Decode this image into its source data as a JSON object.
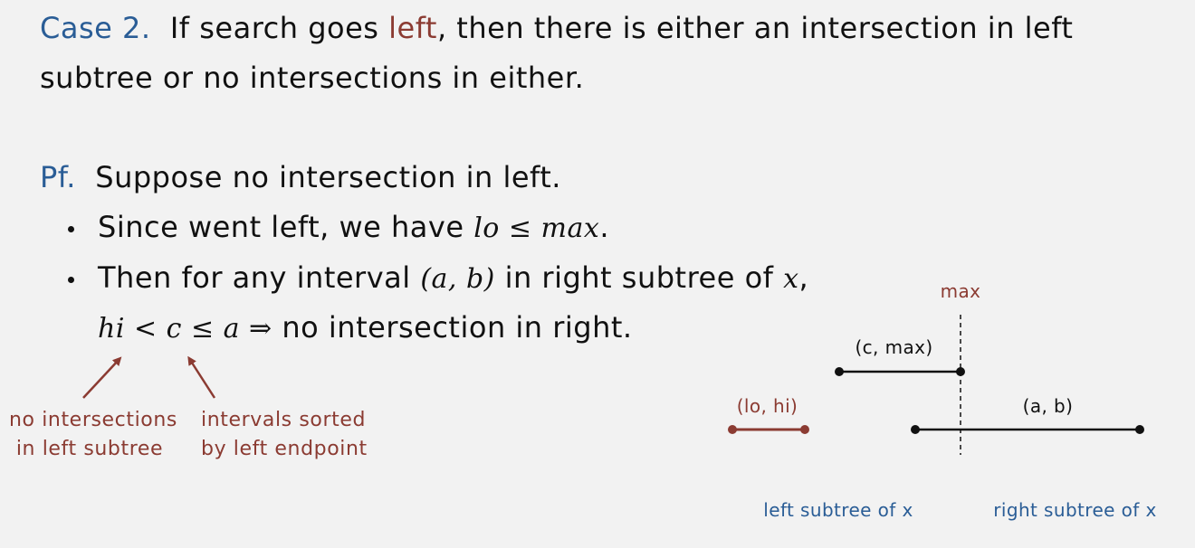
{
  "case2": {
    "label": "Case 2.",
    "text1": "If search goes",
    "left_word": "left",
    "text2": ", then there is either an intersection in left",
    "line2": "subtree or no intersections in either."
  },
  "pf": {
    "label": "Pf.",
    "text": "Suppose no intersection in left."
  },
  "bullet1": {
    "text": "Since went left, we have",
    "math": "lo ≤ max",
    "period": "."
  },
  "bullet2": {
    "text1": "Then for any interval",
    "math_interval": "(a, b)",
    "text2": "in right subtree of",
    "math_x": "x",
    "comma": ","
  },
  "implication": {
    "math": "hi < c ≤ a ⇒",
    "text": "no intersection in right."
  },
  "annotations": {
    "left_note_line1": "no intersections",
    "left_note_line2": "in left subtree",
    "right_note_line1": "intervals sorted",
    "right_note_line2": "by left endpoint"
  },
  "diagram": {
    "max_label": "max",
    "c_max_label": "(c, max)",
    "lo_hi_label": "(lo, hi)",
    "a_b_label": "(a, b)",
    "left_subtree_label": "left subtree of x",
    "right_subtree_label": "right subtree of x"
  },
  "colors": {
    "blue": "#2a5d96",
    "red": "#8b3b32",
    "black": "#111111",
    "background": "#f2f2f2"
  }
}
